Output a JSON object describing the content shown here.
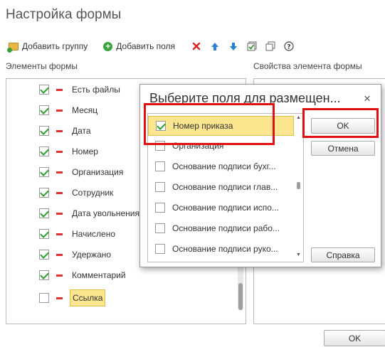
{
  "window": {
    "title": "Настройка формы"
  },
  "toolbar": {
    "add_group": "Добавить группу",
    "add_fields": "Добавить поля",
    "icons": [
      "folder-add-icon",
      "plus-circle-icon",
      "delete-icon",
      "move-up-icon",
      "move-down-icon",
      "check-all-icon",
      "copy-icon",
      "help-icon"
    ]
  },
  "form_elements": {
    "label": "Элементы формы",
    "items": [
      {
        "label": "Есть файлы",
        "checked": true
      },
      {
        "label": "Месяц",
        "checked": true
      },
      {
        "label": "Дата",
        "checked": true
      },
      {
        "label": "Номер",
        "checked": true
      },
      {
        "label": "Организация",
        "checked": true
      },
      {
        "label": "Сотрудник",
        "checked": true
      },
      {
        "label": "Дата увольнения",
        "checked": true
      },
      {
        "label": "Начислено",
        "checked": true
      },
      {
        "label": "Удержано",
        "checked": true
      },
      {
        "label": "Комментарий",
        "checked": true
      },
      {
        "label": "Ссылка",
        "checked": false
      }
    ]
  },
  "properties": {
    "label": "Свойства элемента формы"
  },
  "footer": {
    "ok": "OK"
  },
  "dialog": {
    "title": "Выберите поля для размещен...",
    "close": "×",
    "items": [
      {
        "label": "Номер приказа",
        "checked": true
      },
      {
        "label": "Организация",
        "checked": false
      },
      {
        "label": "Основание подписи бухг...",
        "checked": false
      },
      {
        "label": "Основание подписи глав...",
        "checked": false
      },
      {
        "label": "Основание подписи испо...",
        "checked": false
      },
      {
        "label": "Основание подписи рабо...",
        "checked": false
      },
      {
        "label": "Основание подписи руко...",
        "checked": false
      }
    ],
    "ok": "OK",
    "cancel": "Отмена",
    "help": "Справка"
  },
  "colors": {
    "highlight": "#fbe58f",
    "annotation": "#e01010",
    "check": "#2e9e2e"
  }
}
